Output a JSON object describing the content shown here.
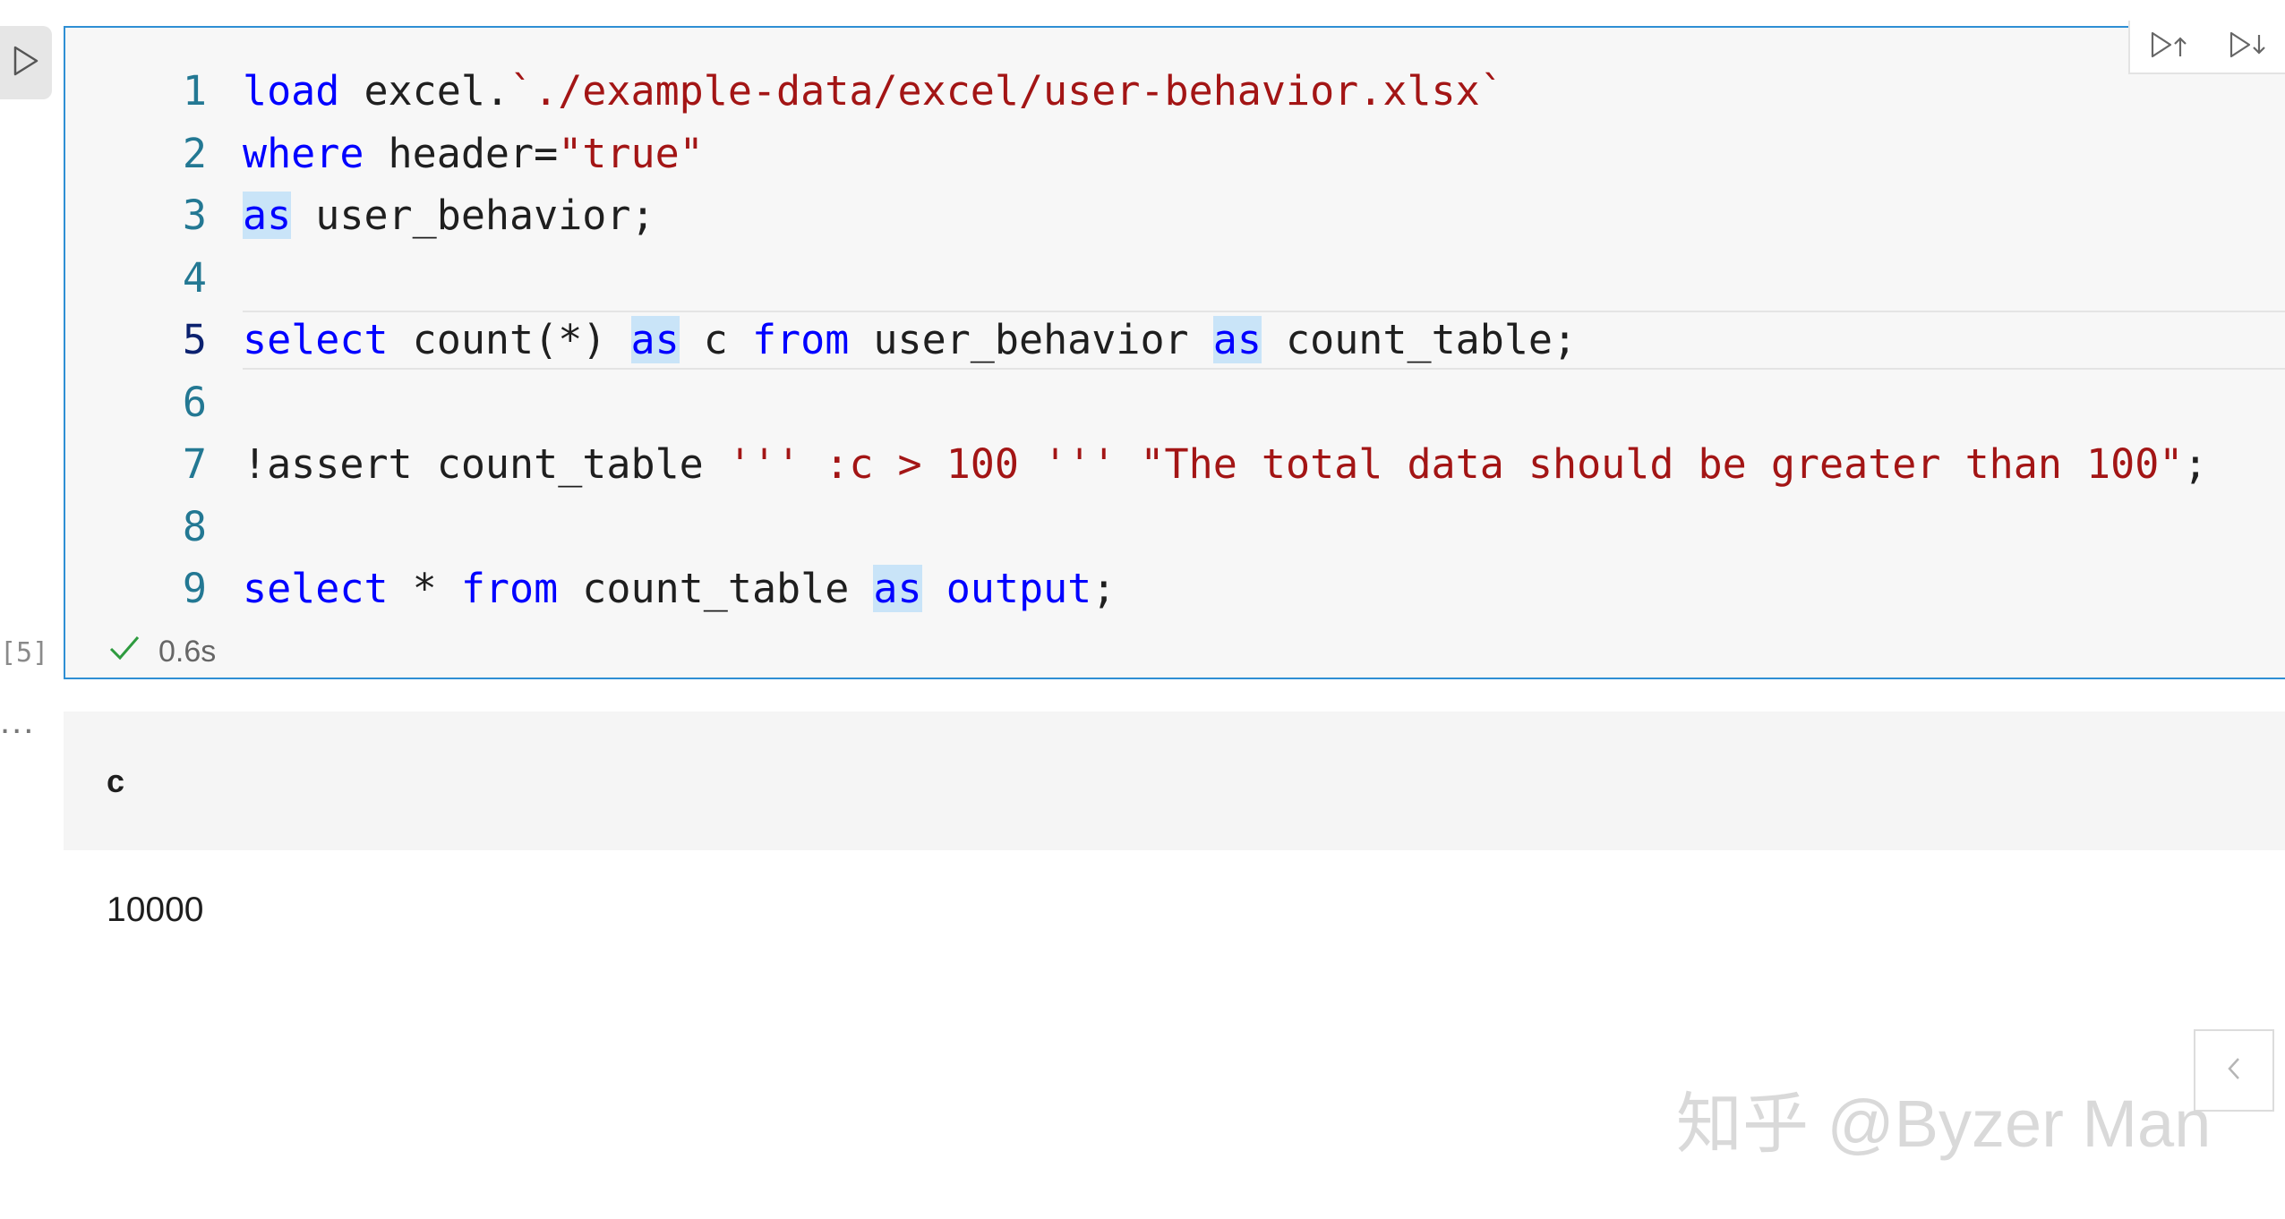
{
  "cell": {
    "execution_count": "[5]",
    "status_time": "0.6s",
    "lines": [
      {
        "n": "1",
        "tokens": [
          {
            "t": "load",
            "c": "kw"
          },
          {
            "t": " excel.",
            "c": ""
          },
          {
            "t": "`./example-data/excel/user-behavior.xlsx`",
            "c": "str"
          }
        ]
      },
      {
        "n": "2",
        "tokens": [
          {
            "t": "where",
            "c": "kw"
          },
          {
            "t": " header=",
            "c": ""
          },
          {
            "t": "\"true\"",
            "c": "str"
          }
        ]
      },
      {
        "n": "3",
        "tokens": [
          {
            "t": "as",
            "c": "kw hl"
          },
          {
            "t": " user_behavior;",
            "c": ""
          }
        ]
      },
      {
        "n": "4",
        "tokens": []
      },
      {
        "n": "5",
        "current": true,
        "tokens": [
          {
            "t": "select",
            "c": "kw"
          },
          {
            "t": " count(*) ",
            "c": ""
          },
          {
            "t": "as",
            "c": "kw hl"
          },
          {
            "t": " c ",
            "c": ""
          },
          {
            "t": "from",
            "c": "kw"
          },
          {
            "t": " user_behavior ",
            "c": ""
          },
          {
            "t": "as",
            "c": "kw hl"
          },
          {
            "t": " count_table;",
            "c": ""
          }
        ]
      },
      {
        "n": "6",
        "tokens": []
      },
      {
        "n": "7",
        "tokens": [
          {
            "t": "!assert count_table ",
            "c": ""
          },
          {
            "t": "''' :c > 100 ''' \"The total data should be greater than 100\"",
            "c": "str"
          },
          {
            "t": ";",
            "c": ""
          }
        ]
      },
      {
        "n": "8",
        "tokens": []
      },
      {
        "n": "9",
        "tokens": [
          {
            "t": "select",
            "c": "kw"
          },
          {
            "t": " * ",
            "c": ""
          },
          {
            "t": "from",
            "c": "kw"
          },
          {
            "t": " count_table ",
            "c": ""
          },
          {
            "t": "as",
            "c": "kw hl"
          },
          {
            "t": " ",
            "c": ""
          },
          {
            "t": "output",
            "c": "kw"
          },
          {
            "t": ";",
            "c": ""
          }
        ]
      }
    ]
  },
  "output": {
    "more_indicator": "...",
    "column": "c",
    "value": "10000"
  },
  "icons": {
    "run": "play-icon",
    "run_above": "run-above-icon",
    "run_below": "run-below-icon",
    "split": "split-cell-icon",
    "collapse": "chevron-left-icon",
    "status": "check-icon"
  },
  "watermark": "知乎 @Byzer Man",
  "colors": {
    "cell_border": "#2f8fd4",
    "keyword": "#0000ff",
    "string": "#a31515",
    "line_number": "#237893",
    "selection_highlight": "#c9e4f8",
    "success": "#2e9b3f"
  }
}
